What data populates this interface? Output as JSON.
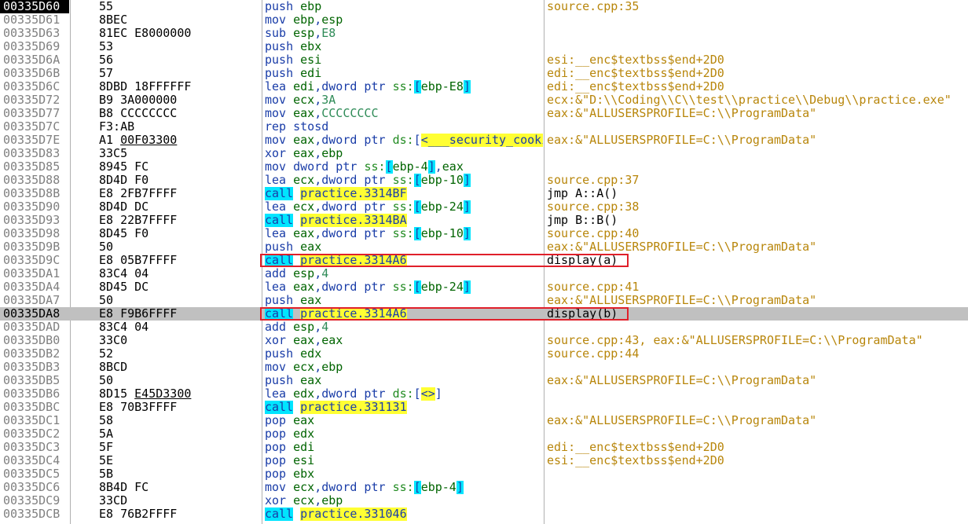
{
  "rows": [
    {
      "addr": "00335D60",
      "bytes": "55",
      "instr": [
        [
          "mn",
          "push"
        ],
        [
          "sp",
          " "
        ],
        [
          "reg",
          "ebp"
        ]
      ],
      "comment": "source.cpp:35",
      "current": true
    },
    {
      "addr": "00335D61",
      "bytes": "8BEC",
      "instr": [
        [
          "mn",
          "mov"
        ],
        [
          "sp",
          " "
        ],
        [
          "reg",
          "ebp"
        ],
        [
          "op",
          ","
        ],
        [
          "reg",
          "esp"
        ]
      ],
      "comment": ""
    },
    {
      "addr": "00335D63",
      "bytes": "81EC E8000000",
      "instr": [
        [
          "mn",
          "sub"
        ],
        [
          "sp",
          " "
        ],
        [
          "reg",
          "esp"
        ],
        [
          "op",
          ","
        ],
        [
          "num",
          "E8"
        ]
      ],
      "comment": ""
    },
    {
      "addr": "00335D69",
      "bytes": "53",
      "instr": [
        [
          "mn",
          "push"
        ],
        [
          "sp",
          " "
        ],
        [
          "reg",
          "ebx"
        ]
      ],
      "comment": ""
    },
    {
      "addr": "00335D6A",
      "bytes": "56",
      "instr": [
        [
          "mn",
          "push"
        ],
        [
          "sp",
          " "
        ],
        [
          "reg",
          "esi"
        ]
      ],
      "comment": "esi:__enc$textbss$end+2D0"
    },
    {
      "addr": "00335D6B",
      "bytes": "57",
      "instr": [
        [
          "mn",
          "push"
        ],
        [
          "sp",
          " "
        ],
        [
          "reg",
          "edi"
        ]
      ],
      "comment": "edi:__enc$textbss$end+2D0"
    },
    {
      "addr": "00335D6C",
      "bytes": "8DBD 18FFFFFF",
      "instr": [
        [
          "mn",
          "lea"
        ],
        [
          "sp",
          " "
        ],
        [
          "reg",
          "edi"
        ],
        [
          "op",
          ",dword ptr "
        ],
        [
          "seg",
          "ss:"
        ],
        [
          "br",
          "["
        ],
        [
          "reg",
          "ebp-E8"
        ],
        [
          "br",
          "]"
        ]
      ],
      "comment": "edi:__enc$textbss$end+2D0"
    },
    {
      "addr": "00335D72",
      "bytes": "B9 3A000000",
      "instr": [
        [
          "mn",
          "mov"
        ],
        [
          "sp",
          " "
        ],
        [
          "reg",
          "ecx"
        ],
        [
          "op",
          ","
        ],
        [
          "num",
          "3A"
        ]
      ],
      "comment": "ecx:&\"D:\\\\Coding\\\\C\\\\test\\\\practice\\\\Debug\\\\practice.exe\""
    },
    {
      "addr": "00335D77",
      "bytes": "B8 CCCCCCCC",
      "instr": [
        [
          "mn",
          "mov"
        ],
        [
          "sp",
          " "
        ],
        [
          "reg",
          "eax"
        ],
        [
          "op",
          ","
        ],
        [
          "num",
          "CCCCCCCC"
        ]
      ],
      "comment": "eax:&\"ALLUSERSPROFILE=C:\\\\ProgramData\""
    },
    {
      "addr": "00335D7C",
      "bytes": "F3:AB",
      "instr": [
        [
          "mn",
          "rep stosd"
        ]
      ],
      "comment": ""
    },
    {
      "addr": "00335D7E",
      "bytes": "A1 00F03300",
      "bytesUnderline": "00F03300",
      "instr": [
        [
          "mn",
          "mov"
        ],
        [
          "sp",
          " "
        ],
        [
          "reg",
          "eax"
        ],
        [
          "op",
          ",dword ptr "
        ],
        [
          "seg",
          "ds:"
        ],
        [
          "op",
          "["
        ],
        [
          "sym",
          "<___security_cookie>"
        ],
        [
          "op",
          "]"
        ]
      ],
      "comment": "eax:&\"ALLUSERSPROFILE=C:\\\\ProgramData\""
    },
    {
      "addr": "00335D83",
      "bytes": "33C5",
      "instr": [
        [
          "mn",
          "xor"
        ],
        [
          "sp",
          " "
        ],
        [
          "reg",
          "eax"
        ],
        [
          "op",
          ","
        ],
        [
          "reg",
          "ebp"
        ]
      ],
      "comment": ""
    },
    {
      "addr": "00335D85",
      "bytes": "8945 FC",
      "instr": [
        [
          "mn",
          "mov"
        ],
        [
          "sp",
          " "
        ],
        [
          "op",
          "dword ptr "
        ],
        [
          "seg",
          "ss:"
        ],
        [
          "br",
          "["
        ],
        [
          "reg",
          "ebp-4"
        ],
        [
          "br",
          "]"
        ],
        [
          "op",
          ","
        ],
        [
          "reg",
          "eax"
        ]
      ],
      "comment": ""
    },
    {
      "addr": "00335D88",
      "bytes": "8D4D F0",
      "instr": [
        [
          "mn",
          "lea"
        ],
        [
          "sp",
          " "
        ],
        [
          "reg",
          "ecx"
        ],
        [
          "op",
          ",dword ptr "
        ],
        [
          "seg",
          "ss:"
        ],
        [
          "br",
          "["
        ],
        [
          "reg",
          "ebp-10"
        ],
        [
          "br",
          "]"
        ]
      ],
      "comment": "source.cpp:37"
    },
    {
      "addr": "00335D8B",
      "bytes": "E8 2FB7FFFF",
      "instr": [
        [
          "call",
          "call"
        ],
        [
          "sp",
          " "
        ],
        [
          "target",
          "practice.3314BF"
        ]
      ],
      "comment": "jmp A::A()",
      "commentDark": true
    },
    {
      "addr": "00335D90",
      "bytes": "8D4D DC",
      "instr": [
        [
          "mn",
          "lea"
        ],
        [
          "sp",
          " "
        ],
        [
          "reg",
          "ecx"
        ],
        [
          "op",
          ",dword ptr "
        ],
        [
          "seg",
          "ss:"
        ],
        [
          "br",
          "["
        ],
        [
          "reg",
          "ebp-24"
        ],
        [
          "br",
          "]"
        ]
      ],
      "comment": "source.cpp:38"
    },
    {
      "addr": "00335D93",
      "bytes": "E8 22B7FFFF",
      "instr": [
        [
          "call",
          "call"
        ],
        [
          "sp",
          " "
        ],
        [
          "target",
          "practice.3314BA"
        ]
      ],
      "comment": "jmp B::B()",
      "commentDark": true
    },
    {
      "addr": "00335D98",
      "bytes": "8D45 F0",
      "instr": [
        [
          "mn",
          "lea"
        ],
        [
          "sp",
          " "
        ],
        [
          "reg",
          "eax"
        ],
        [
          "op",
          ",dword ptr "
        ],
        [
          "seg",
          "ss:"
        ],
        [
          "br",
          "["
        ],
        [
          "reg",
          "ebp-10"
        ],
        [
          "br",
          "]"
        ]
      ],
      "comment": "source.cpp:40"
    },
    {
      "addr": "00335D9B",
      "bytes": "50",
      "instr": [
        [
          "mn",
          "push"
        ],
        [
          "sp",
          " "
        ],
        [
          "reg",
          "eax"
        ]
      ],
      "comment": "eax:&\"ALLUSERSPROFILE=C:\\\\ProgramData\""
    },
    {
      "addr": "00335D9C",
      "bytes": "E8 05B7FFFF",
      "instr": [
        [
          "call",
          "call"
        ],
        [
          "sp",
          " "
        ],
        [
          "target",
          "practice.3314A6"
        ]
      ],
      "comment": "display(a)",
      "commentDark": true,
      "boxed": true
    },
    {
      "addr": "00335DA1",
      "bytes": "83C4 04",
      "instr": [
        [
          "mn",
          "add"
        ],
        [
          "sp",
          " "
        ],
        [
          "reg",
          "esp"
        ],
        [
          "op",
          ","
        ],
        [
          "num",
          "4"
        ]
      ],
      "comment": ""
    },
    {
      "addr": "00335DA4",
      "bytes": "8D45 DC",
      "instr": [
        [
          "mn",
          "lea"
        ],
        [
          "sp",
          " "
        ],
        [
          "reg",
          "eax"
        ],
        [
          "op",
          ",dword ptr "
        ],
        [
          "seg",
          "ss:"
        ],
        [
          "br",
          "["
        ],
        [
          "reg",
          "ebp-24"
        ],
        [
          "br",
          "]"
        ]
      ],
      "comment": "source.cpp:41"
    },
    {
      "addr": "00335DA7",
      "bytes": "50",
      "instr": [
        [
          "mn",
          "push"
        ],
        [
          "sp",
          " "
        ],
        [
          "reg",
          "eax"
        ]
      ],
      "comment": "eax:&\"ALLUSERSPROFILE=C:\\\\ProgramData\""
    },
    {
      "addr": "00335DA8",
      "bytes": "E8 F9B6FFFF",
      "instr": [
        [
          "call",
          "call"
        ],
        [
          "sp",
          " "
        ],
        [
          "target",
          "practice.3314A6"
        ]
      ],
      "comment": "display(b)",
      "commentDark": true,
      "boxed": true,
      "selected": true
    },
    {
      "addr": "00335DAD",
      "bytes": "83C4 04",
      "instr": [
        [
          "mn",
          "add"
        ],
        [
          "sp",
          " "
        ],
        [
          "reg",
          "esp"
        ],
        [
          "op",
          ","
        ],
        [
          "num",
          "4"
        ]
      ],
      "comment": ""
    },
    {
      "addr": "00335DB0",
      "bytes": "33C0",
      "instr": [
        [
          "mn",
          "xor"
        ],
        [
          "sp",
          " "
        ],
        [
          "reg",
          "eax"
        ],
        [
          "op",
          ","
        ],
        [
          "reg",
          "eax"
        ]
      ],
      "comment": "source.cpp:43, eax:&\"ALLUSERSPROFILE=C:\\\\ProgramData\""
    },
    {
      "addr": "00335DB2",
      "bytes": "52",
      "instr": [
        [
          "mn",
          "push"
        ],
        [
          "sp",
          " "
        ],
        [
          "reg",
          "edx"
        ]
      ],
      "comment": "source.cpp:44"
    },
    {
      "addr": "00335DB3",
      "bytes": "8BCD",
      "instr": [
        [
          "mn",
          "mov"
        ],
        [
          "sp",
          " "
        ],
        [
          "reg",
          "ecx"
        ],
        [
          "op",
          ","
        ],
        [
          "reg",
          "ebp"
        ]
      ],
      "comment": ""
    },
    {
      "addr": "00335DB5",
      "bytes": "50",
      "instr": [
        [
          "mn",
          "push"
        ],
        [
          "sp",
          " "
        ],
        [
          "reg",
          "eax"
        ]
      ],
      "comment": "eax:&\"ALLUSERSPROFILE=C:\\\\ProgramData\""
    },
    {
      "addr": "00335DB6",
      "bytes": "8D15 E45D3300",
      "bytesUnderline": "E45D3300",
      "instr": [
        [
          "mn",
          "lea"
        ],
        [
          "sp",
          " "
        ],
        [
          "reg",
          "edx"
        ],
        [
          "op",
          ",dword ptr "
        ],
        [
          "seg",
          "ds:"
        ],
        [
          "op",
          "["
        ],
        [
          "sym",
          "<>"
        ],
        [
          "op",
          "]"
        ]
      ],
      "comment": ""
    },
    {
      "addr": "00335DBC",
      "bytes": "E8 70B3FFFF",
      "instr": [
        [
          "call",
          "call"
        ],
        [
          "sp",
          " "
        ],
        [
          "target",
          "practice.331131"
        ]
      ],
      "comment": ""
    },
    {
      "addr": "00335DC1",
      "bytes": "58",
      "instr": [
        [
          "mn",
          "pop"
        ],
        [
          "sp",
          " "
        ],
        [
          "reg",
          "eax"
        ]
      ],
      "comment": "eax:&\"ALLUSERSPROFILE=C:\\\\ProgramData\""
    },
    {
      "addr": "00335DC2",
      "bytes": "5A",
      "instr": [
        [
          "mn",
          "pop"
        ],
        [
          "sp",
          " "
        ],
        [
          "reg",
          "edx"
        ]
      ],
      "comment": ""
    },
    {
      "addr": "00335DC3",
      "bytes": "5F",
      "instr": [
        [
          "mn",
          "pop"
        ],
        [
          "sp",
          " "
        ],
        [
          "reg",
          "edi"
        ]
      ],
      "comment": "edi:__enc$textbss$end+2D0"
    },
    {
      "addr": "00335DC4",
      "bytes": "5E",
      "instr": [
        [
          "mn",
          "pop"
        ],
        [
          "sp",
          " "
        ],
        [
          "reg",
          "esi"
        ]
      ],
      "comment": "esi:__enc$textbss$end+2D0"
    },
    {
      "addr": "00335DC5",
      "bytes": "5B",
      "instr": [
        [
          "mn",
          "pop"
        ],
        [
          "sp",
          " "
        ],
        [
          "reg",
          "ebx"
        ]
      ],
      "comment": ""
    },
    {
      "addr": "00335DC6",
      "bytes": "8B4D FC",
      "instr": [
        [
          "mn",
          "mov"
        ],
        [
          "sp",
          " "
        ],
        [
          "reg",
          "ecx"
        ],
        [
          "op",
          ",dword ptr "
        ],
        [
          "seg",
          "ss:"
        ],
        [
          "br",
          "["
        ],
        [
          "reg",
          "ebp-4"
        ],
        [
          "br",
          "]"
        ]
      ],
      "comment": ""
    },
    {
      "addr": "00335DC9",
      "bytes": "33CD",
      "instr": [
        [
          "mn",
          "xor"
        ],
        [
          "sp",
          " "
        ],
        [
          "reg",
          "ecx"
        ],
        [
          "op",
          ","
        ],
        [
          "reg",
          "ebp"
        ]
      ],
      "comment": ""
    },
    {
      "addr": "00335DCB",
      "bytes": "E8 76B2FFFF",
      "instr": [
        [
          "call",
          "call"
        ],
        [
          "sp",
          " "
        ],
        [
          "target",
          "practice.331046"
        ]
      ],
      "comment": ""
    }
  ],
  "colors": {
    "background": "#ffffff",
    "selected_row": "#c0c0c0",
    "current_address_bg": "#000000",
    "call_highlight": "#00e5ff",
    "target_highlight": "#ffff33",
    "comment": "#b8860b",
    "box": "#e0202a"
  }
}
